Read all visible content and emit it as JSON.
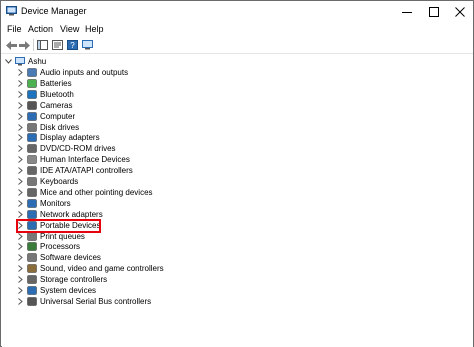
{
  "window": {
    "title": "Device Manager",
    "controls": {
      "minimize_icon": "minimize-icon",
      "maximize_icon": "maximize-icon",
      "close_icon": "close-icon"
    }
  },
  "menu": [
    "File",
    "Action",
    "View",
    "Help"
  ],
  "toolbar": {
    "buttons": [
      "back-icon",
      "forward-icon",
      "show-hide-console-tree-icon",
      "help-icon",
      "properties-icon",
      "monitor-icon"
    ]
  },
  "tree": {
    "root": "Ashu",
    "items": [
      "Audio inputs and outputs",
      "Batteries",
      "Bluetooth",
      "Cameras",
      "Computer",
      "Disk drives",
      "Display adapters",
      "DVD/CD-ROM drives",
      "Human Interface Devices",
      "IDE ATA/ATAPI controllers",
      "Keyboards",
      "Mice and other pointing devices",
      "Monitors",
      "Network adapters",
      "Portable Devices",
      "Print queues",
      "Processors",
      "Software devices",
      "Sound, video and game controllers",
      "Storage controllers",
      "System devices",
      "Universal Serial Bus controllers"
    ],
    "highlighted": "Portable Devices"
  },
  "colors": {
    "highlight_border": "#e8000b",
    "accent": "#1e73be"
  }
}
